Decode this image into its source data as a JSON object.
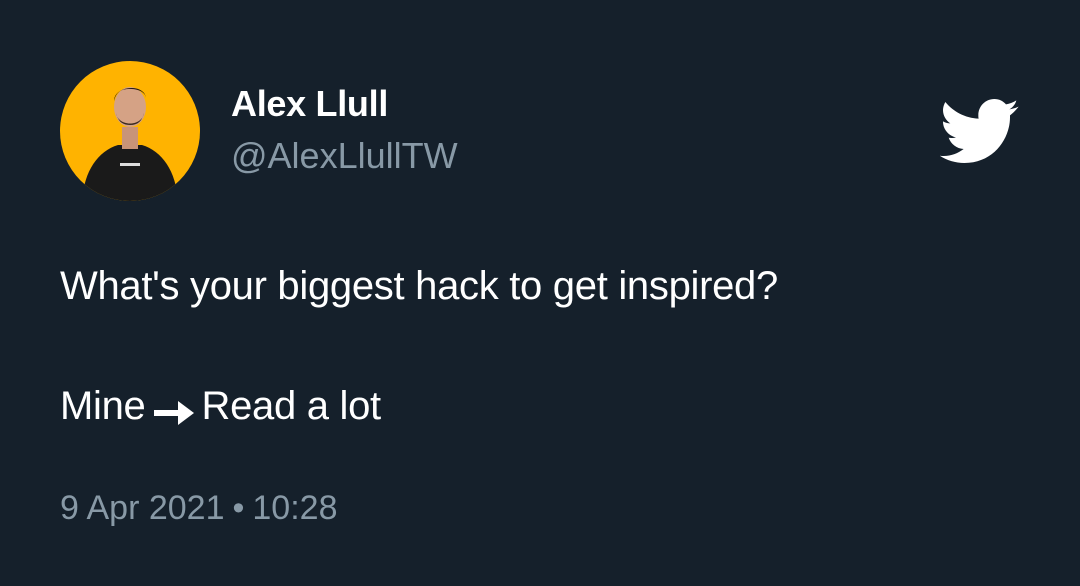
{
  "author": {
    "name": "Alex Llull",
    "handle": "@AlexLlullTW",
    "avatar_bg": "#ffb300"
  },
  "tweet": {
    "line1": "What's your biggest hack to get inspired?",
    "line2_before": "Mine",
    "line2_icon": "right-arrow-emoji",
    "line2_after": "Read a lot"
  },
  "meta": {
    "date": "9 Apr 2021",
    "separator": "•",
    "time": "10:28"
  },
  "brand": {
    "icon": "twitter-bird-icon",
    "color": "#ffffff"
  },
  "colors": {
    "background": "#15202b",
    "secondary_text": "#8899a6"
  }
}
